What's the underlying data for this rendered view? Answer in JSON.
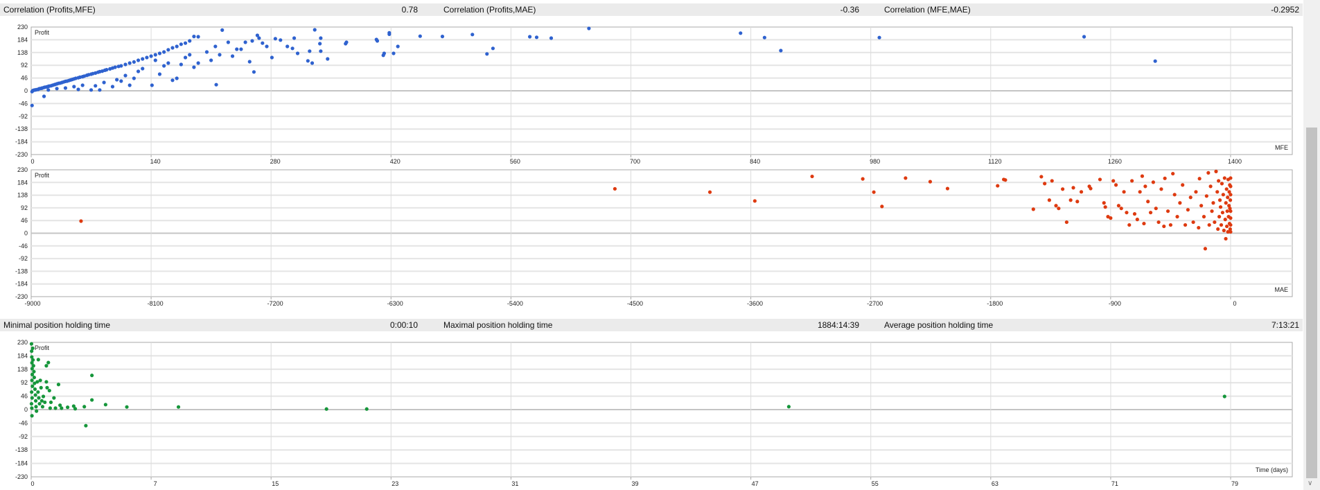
{
  "header_top": {
    "items": [
      {
        "label": "Correlation (Profits,MFE)",
        "value": "0.78"
      },
      {
        "label": "Correlation (Profits,MAE)",
        "value": "-0.36"
      },
      {
        "label": "Correlation (MFE,MAE)",
        "value": "-0.2952"
      }
    ]
  },
  "header_mid": {
    "items": [
      {
        "label": "Minimal position holding time",
        "value": "0:00:10"
      },
      {
        "label": "Maximal position holding time",
        "value": "1884:14:39"
      },
      {
        "label": "Average position holding time",
        "value": "7:13:21"
      }
    ]
  },
  "colors": {
    "mfe": "#2f62cf",
    "mae": "#de3a10",
    "time": "#16963b",
    "header_bg": "#ebebeb"
  },
  "scrollbar": {
    "icon": "chevron-down-icon"
  },
  "chart_data": [
    {
      "type": "scatter",
      "ylabel": "Profit",
      "xlabel": "MFE",
      "xlim": [
        0,
        1472
      ],
      "ylim": [
        -230,
        230
      ],
      "grid": true,
      "xticks": [
        0,
        140,
        280,
        420,
        560,
        700,
        840,
        980,
        1120,
        1260,
        1400
      ],
      "yticks": [
        230,
        184,
        138,
        92,
        46,
        0,
        -46,
        -92,
        -138,
        -184,
        -230
      ],
      "points": [
        [
          1,
          -3
        ],
        [
          2,
          1
        ],
        [
          3,
          2
        ],
        [
          4,
          3
        ],
        [
          5,
          3
        ],
        [
          6,
          4
        ],
        [
          8,
          5
        ],
        [
          9,
          7
        ],
        [
          10,
          8
        ],
        [
          12,
          9
        ],
        [
          13,
          10
        ],
        [
          15,
          12
        ],
        [
          16,
          13
        ],
        [
          18,
          14
        ],
        [
          20,
          16
        ],
        [
          21,
          17
        ],
        [
          23,
          18
        ],
        [
          25,
          20
        ],
        [
          27,
          22
        ],
        [
          28,
          23
        ],
        [
          30,
          25
        ],
        [
          32,
          27
        ],
        [
          34,
          28
        ],
        [
          36,
          30
        ],
        [
          38,
          32
        ],
        [
          40,
          34
        ],
        [
          42,
          35
        ],
        [
          44,
          37
        ],
        [
          46,
          39
        ],
        [
          48,
          41
        ],
        [
          50,
          43
        ],
        [
          52,
          45
        ],
        [
          55,
          47
        ],
        [
          57,
          49
        ],
        [
          60,
          51
        ],
        [
          62,
          53
        ],
        [
          65,
          56
        ],
        [
          67,
          58
        ],
        [
          70,
          60
        ],
        [
          72,
          62
        ],
        [
          75,
          64
        ],
        [
          78,
          67
        ],
        [
          80,
          69
        ],
        [
          83,
          71
        ],
        [
          86,
          74
        ],
        [
          88,
          76
        ],
        [
          92,
          79
        ],
        [
          95,
          82
        ],
        [
          98,
          85
        ],
        [
          102,
          88
        ],
        [
          105,
          90
        ],
        [
          110,
          95
        ],
        [
          115,
          100
        ],
        [
          120,
          104
        ],
        [
          125,
          110
        ],
        [
          130,
          115
        ],
        [
          135,
          120
        ],
        [
          140,
          125
        ],
        [
          145,
          130
        ],
        [
          150,
          135
        ],
        [
          155,
          140
        ],
        [
          160,
          148
        ],
        [
          165,
          155
        ],
        [
          170,
          160
        ],
        [
          175,
          168
        ],
        [
          180,
          172
        ],
        [
          185,
          180
        ],
        [
          190,
          196
        ],
        [
          195,
          195
        ],
        [
          15,
          -20
        ],
        [
          1,
          -53
        ],
        [
          20,
          3
        ],
        [
          30,
          8
        ],
        [
          40,
          10
        ],
        [
          50,
          15
        ],
        [
          55,
          5
        ],
        [
          60,
          20
        ],
        [
          70,
          3
        ],
        [
          75,
          18
        ],
        [
          80,
          3
        ],
        [
          85,
          30
        ],
        [
          95,
          15
        ],
        [
          100,
          40
        ],
        [
          105,
          35
        ],
        [
          110,
          55
        ],
        [
          115,
          20
        ],
        [
          120,
          45
        ],
        [
          125,
          70
        ],
        [
          130,
          80
        ],
        [
          141,
          20
        ],
        [
          145,
          110
        ],
        [
          150,
          60
        ],
        [
          155,
          90
        ],
        [
          160,
          100
        ],
        [
          165,
          38
        ],
        [
          170,
          45
        ],
        [
          175,
          95
        ],
        [
          180,
          120
        ],
        [
          185,
          130
        ],
        [
          190,
          85
        ],
        [
          195,
          100
        ],
        [
          205,
          140
        ],
        [
          210,
          110
        ],
        [
          216,
          22
        ],
        [
          215,
          160
        ],
        [
          220,
          130
        ],
        [
          223,
          219
        ],
        [
          230,
          175
        ],
        [
          235,
          125
        ],
        [
          240,
          150
        ],
        [
          245,
          150
        ],
        [
          250,
          175
        ],
        [
          255,
          105
        ],
        [
          258,
          180
        ],
        [
          260,
          68
        ],
        [
          264,
          200
        ],
        [
          266,
          190
        ],
        [
          270,
          172
        ],
        [
          275,
          160
        ],
        [
          281,
          120
        ],
        [
          285,
          188
        ],
        [
          291,
          183
        ],
        [
          299,
          160
        ],
        [
          305,
          153
        ],
        [
          307,
          190
        ],
        [
          311,
          135
        ],
        [
          323,
          108
        ],
        [
          325,
          143
        ],
        [
          328,
          100
        ],
        [
          331,
          220
        ],
        [
          337,
          170
        ],
        [
          338,
          190
        ],
        [
          338,
          143
        ],
        [
          346,
          115
        ],
        [
          367,
          170
        ],
        [
          368,
          175
        ],
        [
          403,
          185
        ],
        [
          404,
          180
        ],
        [
          411,
          128
        ],
        [
          412,
          135
        ],
        [
          418,
          209
        ],
        [
          418,
          204
        ],
        [
          423,
          135
        ],
        [
          428,
          160
        ],
        [
          454,
          197
        ],
        [
          480,
          196
        ],
        [
          515,
          203
        ],
        [
          532,
          133
        ],
        [
          539,
          153
        ],
        [
          582,
          195
        ],
        [
          590,
          193
        ],
        [
          607,
          190
        ],
        [
          651,
          225
        ],
        [
          828,
          208
        ],
        [
          856,
          192
        ],
        [
          875,
          145
        ],
        [
          990,
          192
        ],
        [
          1229,
          195
        ],
        [
          1312,
          107
        ]
      ]
    },
    {
      "type": "scatter",
      "ylabel": "Profit",
      "xlabel": "MAE",
      "xlim": [
        -9000,
        463
      ],
      "ylim": [
        -230,
        230
      ],
      "grid": true,
      "xticks": [
        -9000,
        -8100,
        -7200,
        -6300,
        -5400,
        -4500,
        -3600,
        -2700,
        -1800,
        -900,
        0
      ],
      "yticks": [
        230,
        184,
        138,
        92,
        46,
        0,
        -46,
        -92,
        -138,
        -184,
        -230
      ],
      "points": [
        [
          -8626,
          44
        ],
        [
          -4620,
          161
        ],
        [
          -3907,
          149
        ],
        [
          -3570,
          117
        ],
        [
          -3140,
          206
        ],
        [
          -2760,
          197
        ],
        [
          -2677,
          149
        ],
        [
          -2616,
          97
        ],
        [
          -2439,
          200
        ],
        [
          -2254,
          187
        ],
        [
          -2124,
          162
        ],
        [
          -1748,
          172
        ],
        [
          -1702,
          195
        ],
        [
          -1690,
          193
        ],
        [
          -1480,
          87
        ],
        [
          -1420,
          205
        ],
        [
          -1395,
          180
        ],
        [
          -1360,
          120
        ],
        [
          -1340,
          190
        ],
        [
          -1310,
          100
        ],
        [
          -1290,
          90
        ],
        [
          -1260,
          160
        ],
        [
          -1230,
          40
        ],
        [
          -1200,
          120
        ],
        [
          -1180,
          165
        ],
        [
          -1150,
          115
        ],
        [
          -1120,
          150
        ],
        [
          -1060,
          170
        ],
        [
          -1050,
          162
        ],
        [
          -980,
          195
        ],
        [
          -950,
          110
        ],
        [
          -940,
          95
        ],
        [
          -920,
          60
        ],
        [
          -900,
          55
        ],
        [
          -880,
          190
        ],
        [
          -860,
          175
        ],
        [
          -840,
          100
        ],
        [
          -820,
          90
        ],
        [
          -800,
          150
        ],
        [
          -780,
          75
        ],
        [
          -760,
          30
        ],
        [
          -740,
          190
        ],
        [
          -720,
          70
        ],
        [
          -700,
          50
        ],
        [
          -680,
          150
        ],
        [
          -663,
          207
        ],
        [
          -650,
          35
        ],
        [
          -640,
          170
        ],
        [
          -620,
          115
        ],
        [
          -600,
          75
        ],
        [
          -580,
          185
        ],
        [
          -560,
          90
        ],
        [
          -540,
          40
        ],
        [
          -520,
          160
        ],
        [
          -500,
          25
        ],
        [
          -493,
          199
        ],
        [
          -470,
          80
        ],
        [
          -450,
          30
        ],
        [
          -433,
          216
        ],
        [
          -420,
          140
        ],
        [
          -400,
          60
        ],
        [
          -380,
          110
        ],
        [
          -360,
          175
        ],
        [
          -340,
          30
        ],
        [
          -320,
          85
        ],
        [
          -300,
          130
        ],
        [
          -280,
          40
        ],
        [
          -260,
          150
        ],
        [
          -240,
          20
        ],
        [
          -233,
          198
        ],
        [
          -220,
          100
        ],
        [
          -200,
          60
        ],
        [
          -190,
          -56
        ],
        [
          -180,
          135
        ],
        [
          -167,
          219
        ],
        [
          -160,
          30
        ],
        [
          -150,
          170
        ],
        [
          -140,
          80
        ],
        [
          -130,
          110
        ],
        [
          -120,
          40
        ],
        [
          -109,
          224
        ],
        [
          -100,
          150
        ],
        [
          -95,
          15
        ],
        [
          -90,
          190
        ],
        [
          -85,
          60
        ],
        [
          -80,
          120
        ],
        [
          -75,
          95
        ],
        [
          -70,
          30
        ],
        [
          -65,
          180
        ],
        [
          -60,
          75
        ],
        [
          -55,
          140
        ],
        [
          -50,
          10
        ],
        [
          -45,
          200
        ],
        [
          -40,
          50
        ],
        [
          -36,
          -20
        ],
        [
          -35,
          110
        ],
        [
          -30,
          160
        ],
        [
          -28,
          25
        ],
        [
          -25,
          80
        ],
        [
          -22,
          130
        ],
        [
          -20,
          5
        ],
        [
          -18,
          195
        ],
        [
          -15,
          60
        ],
        [
          -12,
          100
        ],
        [
          -10,
          150
        ],
        [
          -8,
          35
        ],
        [
          -6,
          175
        ],
        [
          -5,
          90
        ],
        [
          -3,
          15
        ],
        [
          -2,
          120
        ],
        [
          0,
          55
        ],
        [
          0,
          200
        ],
        [
          0,
          5
        ],
        [
          0,
          140
        ],
        [
          0,
          80
        ],
        [
          0,
          30
        ],
        [
          0,
          170
        ]
      ]
    },
    {
      "type": "scatter",
      "ylabel": "Profit",
      "xlabel": "Time (days)",
      "xlim": [
        0,
        83.06
      ],
      "ylim": [
        -230,
        230
      ],
      "grid": true,
      "xticks": [
        0,
        7,
        15,
        23,
        31,
        39,
        47,
        55,
        63,
        71,
        79
      ],
      "yticks": [
        230,
        184,
        138,
        92,
        46,
        0,
        -46,
        -92,
        -138,
        -184,
        -230
      ],
      "points": [
        [
          0.02,
          225
        ],
        [
          0.03,
          200
        ],
        [
          0.04,
          180
        ],
        [
          0.05,
          160
        ],
        [
          0.06,
          140
        ],
        [
          0.07,
          120
        ],
        [
          0.05,
          100
        ],
        [
          0.08,
          80
        ],
        [
          0.03,
          60
        ],
        [
          0.06,
          40
        ],
        [
          0.02,
          20
        ],
        [
          0.04,
          5
        ],
        [
          0.05,
          -21
        ],
        [
          0.1,
          210
        ],
        [
          0.12,
          170
        ],
        [
          0.15,
          150
        ],
        [
          0.18,
          130
        ],
        [
          0.2,
          110
        ],
        [
          0.22,
          90
        ],
        [
          0.25,
          70
        ],
        [
          0.28,
          50
        ],
        [
          0.3,
          30
        ],
        [
          0.32,
          10
        ],
        [
          0.35,
          -5
        ],
        [
          0.4,
          95
        ],
        [
          0.45,
          60
        ],
        [
          0.47,
          171
        ],
        [
          0.5,
          40
        ],
        [
          0.55,
          20
        ],
        [
          0.6,
          100
        ],
        [
          0.65,
          75
        ],
        [
          0.7,
          30
        ],
        [
          0.75,
          10
        ],
        [
          0.8,
          45
        ],
        [
          0.9,
          25
        ],
        [
          1.0,
          95
        ],
        [
          1.05,
          75
        ],
        [
          1.13,
          161
        ],
        [
          1.0,
          150
        ],
        [
          1.2,
          65
        ],
        [
          1.25,
          5
        ],
        [
          1.3,
          25
        ],
        [
          1.5,
          40
        ],
        [
          1.6,
          5
        ],
        [
          1.8,
          86
        ],
        [
          1.9,
          15
        ],
        [
          2.0,
          5
        ],
        [
          2.4,
          8
        ],
        [
          2.8,
          12
        ],
        [
          2.9,
          3
        ],
        [
          3.5,
          10
        ],
        [
          3.6,
          -55
        ],
        [
          4.0,
          117
        ],
        [
          4.0,
          33
        ],
        [
          4.9,
          17
        ],
        [
          6.3,
          9
        ],
        [
          9.7,
          9
        ],
        [
          19.45,
          2
        ],
        [
          22.1,
          2
        ],
        [
          49.9,
          10
        ],
        [
          78.6,
          45
        ]
      ]
    }
  ]
}
